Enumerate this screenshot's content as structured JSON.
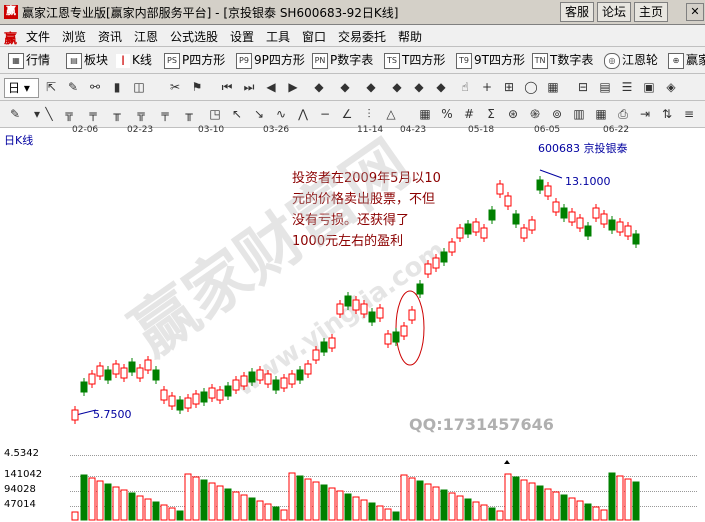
{
  "window": {
    "title": "赢家江恩专业版[赢家内部服务平台] - [京投银泰   SH600683-92日K线]",
    "buttons": [
      "客服",
      "论坛",
      "主页"
    ]
  },
  "menu": [
    "文件",
    "浏览",
    "资讯",
    "江恩",
    "公式选股",
    "设置",
    "工具",
    "窗口",
    "交易委托",
    "帮助"
  ],
  "toolbar1": [
    "行情",
    "板块",
    "K线",
    "P四方形",
    "9P四方形",
    "P数字表",
    "T四方形",
    "9T四方形",
    "T数字表",
    "江恩轮",
    "赢家"
  ],
  "toolbar2": {
    "period_label": "日"
  },
  "chart": {
    "period_label": "日K线",
    "stock_label": "600683 京投银泰",
    "high_label": "13.1000",
    "low_label": "5.7500",
    "dates": [
      "02-06",
      "02-23",
      "03-10",
      "03-26",
      "11-14",
      "04-23",
      "05-18",
      "06-05",
      "06-22"
    ],
    "annotation": "投资者在2009年5月以10元的价格卖出股票，不但没有亏损。还获得了1000元左右的盈利",
    "volume_axis": [
      "4.5342",
      "141042",
      "94028",
      "47014"
    ],
    "watermark_qq": "QQ:1731457646",
    "watermark_main": "赢家财富网",
    "watermark_url": "www.yingjia.com"
  },
  "colors": {
    "up": "#ff0000",
    "down": "#008000",
    "ann": "#8b0000"
  },
  "chart_data": {
    "type": "candlestick",
    "high": 13.1,
    "low": 5.75,
    "note": "daily K-line rising from ~5.75 to 13.10"
  }
}
